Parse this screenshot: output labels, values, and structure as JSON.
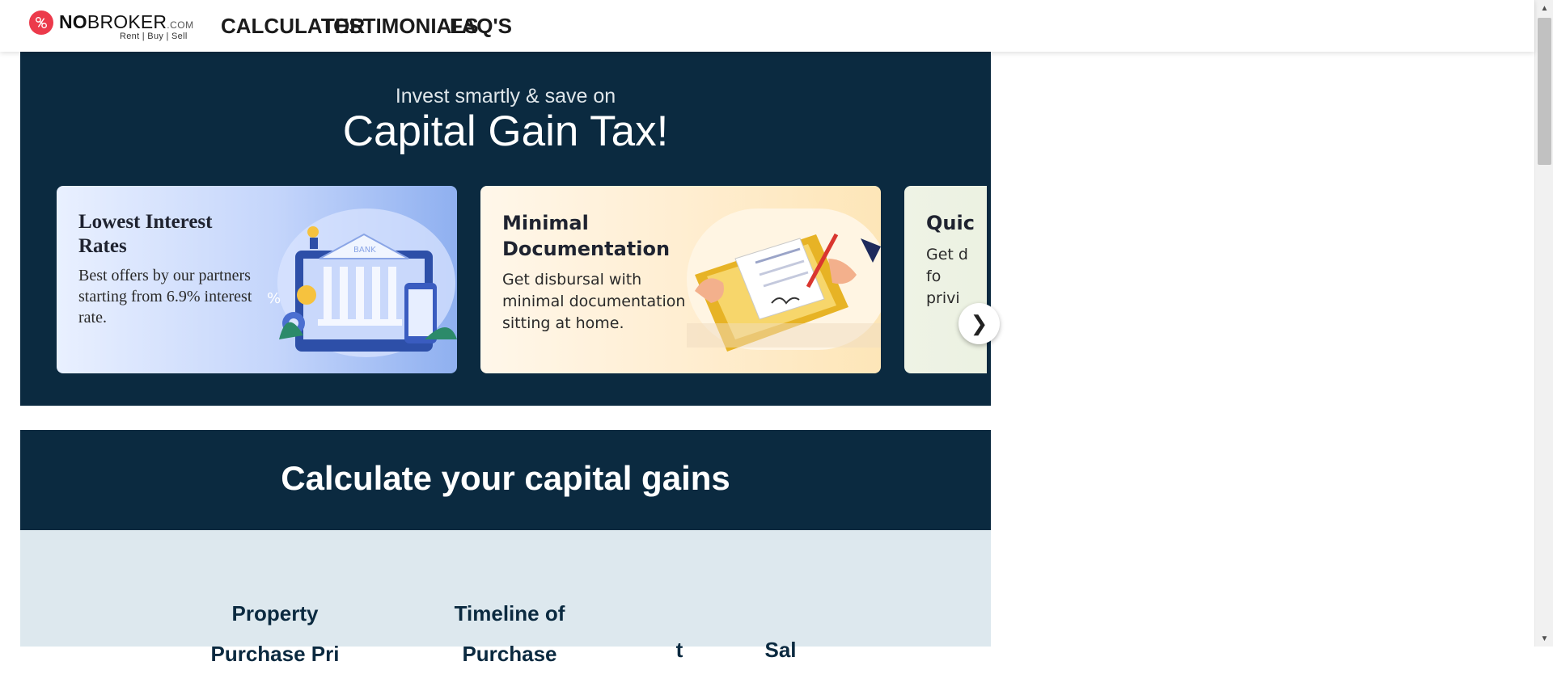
{
  "header": {
    "logo": {
      "brand_no": "NO",
      "brand_rest": "BROKER",
      "brand_suffix": ".COM",
      "tagline": "Rent | Buy | Sell"
    },
    "nav": {
      "calculator": "CALCULATOR",
      "testimonials": "TESTIMONIALS",
      "faqs": "FAQ'S"
    }
  },
  "hero": {
    "subtitle": "Invest smartly & save on",
    "title": "Capital Gain Tax!",
    "cards": [
      {
        "title": "Lowest Interest Rates",
        "desc": "Best offers by our partners starting from 6.9% interest rate.",
        "illustration": "bank-building-illustration"
      },
      {
        "title": "Minimal Documentation",
        "desc": "Get disbursal with minimal documentation sitting at home.",
        "illustration": "document-signing-laptop-illustration"
      },
      {
        "title": "Quic",
        "desc": "Get d\nfo\nprivi"
      }
    ],
    "next_arrow": "❯"
  },
  "calculator": {
    "title": "Calculate your capital gains",
    "columns": [
      {
        "label": "Property Purchase Pri"
      },
      {
        "label": "Timeline of Purchase"
      },
      {
        "label": "t"
      },
      {
        "label": "Sal"
      }
    ]
  },
  "colors": {
    "navy": "#0b2a40",
    "logo_red": "#ec3a4b",
    "calc_bg": "#dde8ee"
  }
}
